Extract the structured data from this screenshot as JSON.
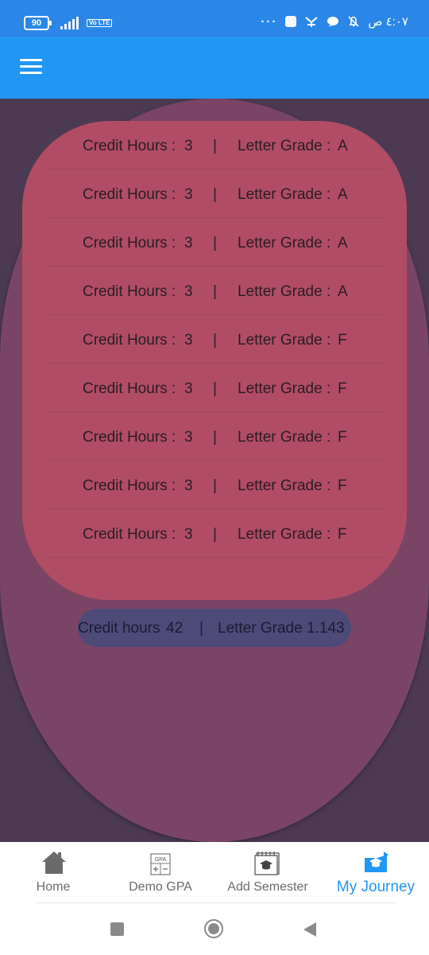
{
  "status_bar": {
    "battery": "90",
    "network": "Vo LTE",
    "time": "٤:٠٧ ص"
  },
  "app_bar": {
    "menu_icon": "menu-icon"
  },
  "courses": [
    {
      "credit_label": "Credit Hours :",
      "credit_value": "3",
      "separator": "|",
      "grade_label": "Letter Grade :",
      "grade_value": "A"
    },
    {
      "credit_label": "Credit Hours :",
      "credit_value": "3",
      "separator": "|",
      "grade_label": "Letter Grade :",
      "grade_value": "A"
    },
    {
      "credit_label": "Credit Hours :",
      "credit_value": "3",
      "separator": "|",
      "grade_label": "Letter Grade :",
      "grade_value": "A"
    },
    {
      "credit_label": "Credit Hours :",
      "credit_value": "3",
      "separator": "|",
      "grade_label": "Letter Grade :",
      "grade_value": "A"
    },
    {
      "credit_label": "Credit Hours :",
      "credit_value": "3",
      "separator": "|",
      "grade_label": "Letter Grade :",
      "grade_value": "F"
    },
    {
      "credit_label": "Credit Hours :",
      "credit_value": "3",
      "separator": "|",
      "grade_label": "Letter Grade :",
      "grade_value": "F"
    },
    {
      "credit_label": "Credit Hours :",
      "credit_value": "3",
      "separator": "|",
      "grade_label": "Letter Grade :",
      "grade_value": "F"
    },
    {
      "credit_label": "Credit Hours :",
      "credit_value": "3",
      "separator": "|",
      "grade_label": "Letter Grade :",
      "grade_value": "F"
    },
    {
      "credit_label": "Credit Hours :",
      "credit_value": "3",
      "separator": "|",
      "grade_label": "Letter Grade :",
      "grade_value": "F"
    }
  ],
  "summary": {
    "credit_label": "Credit hours",
    "credit_value": "42",
    "separator": "|",
    "grade_label": "Letter Grade",
    "grade_value": "1.143"
  },
  "bottom_nav": {
    "items": [
      {
        "label": "Home",
        "icon": "home-icon",
        "active": false
      },
      {
        "label": "Demo GPA",
        "icon": "calculator-icon",
        "icon_text": "GPA",
        "active": false
      },
      {
        "label": "Add Semester",
        "icon": "calendar-graduation-icon",
        "active": false
      },
      {
        "label": "My Journey",
        "icon": "journey-icon",
        "active": true
      }
    ]
  },
  "colors": {
    "app_bar": "#2196f3",
    "status_bar": "#2a87e8",
    "background": "#4c3a52",
    "outer_oval": "#7a4565",
    "card": "#b04d64",
    "summary_pill": "#4d4a78",
    "active_nav": "#2196f3"
  }
}
